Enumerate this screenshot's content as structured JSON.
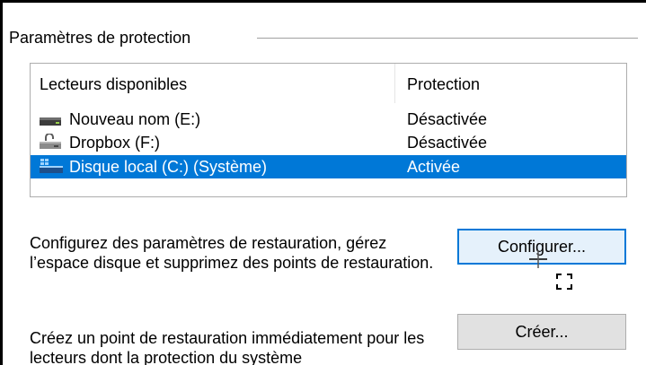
{
  "group": {
    "title": "Paramètres de protection"
  },
  "drives_list": {
    "headers": {
      "drives": "Lecteurs disponibles",
      "protection": "Protection"
    },
    "rows": [
      {
        "name": "Nouveau nom (E:)",
        "status": "Désactivée",
        "icon": "removable-drive-icon",
        "selected": false
      },
      {
        "name": "Dropbox (F:)",
        "status": "Désactivée",
        "icon": "network-drive-icon",
        "selected": false
      },
      {
        "name": "Disque local (C:) (Système)",
        "status": "Activée",
        "icon": "system-drive-icon",
        "selected": true
      }
    ]
  },
  "configure": {
    "description": "Configurez des paramètres de restauration, gérez l’espace disque et supprimez des points de restauration.",
    "button_label": "Configurer..."
  },
  "create": {
    "description": "Créez un point de restauration immédiatement pour les lecteurs dont la protection du système",
    "button_label": "Créer..."
  },
  "colors": {
    "selection": "#0078d7",
    "focused_button_bg": "#e5f1fb",
    "button_bg": "#e1e1e1"
  }
}
